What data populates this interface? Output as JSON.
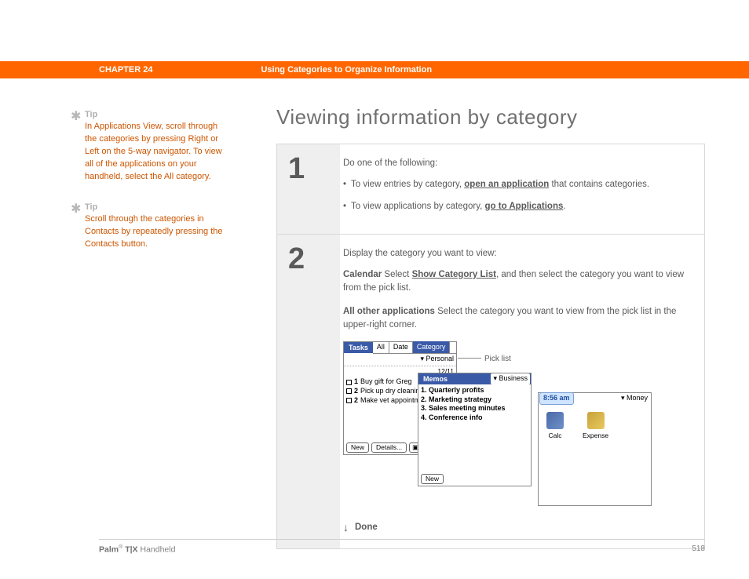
{
  "header": {
    "chapter": "CHAPTER 24",
    "title": "Using Categories to Organize Information"
  },
  "sidebar": {
    "tips": [
      {
        "label": "Tip",
        "text": "In Applications View, scroll through the categories by pressing Right or Left on the 5-way navigator. To view all of the applications on your handheld, select the All category."
      },
      {
        "label": "Tip",
        "text": "Scroll through the categories in Contacts by repeatedly pressing the Contacts button."
      }
    ]
  },
  "page_title": "Viewing information by category",
  "steps": [
    {
      "number": "1",
      "lead": "Do one of the following:",
      "bullets": [
        {
          "pre": "To view entries by category, ",
          "link": "open an application",
          "post": " that contains categories."
        },
        {
          "pre": "To view applications by category, ",
          "link": "go to Applications",
          "post": "."
        }
      ]
    },
    {
      "number": "2",
      "lead": "Display the category you want to view:",
      "paras": [
        {
          "term": "Calendar",
          "pre": "   Select ",
          "link": "Show Category List",
          "post": ", and then select the category you want to view from the pick list."
        },
        {
          "term": "All other applications",
          "pre": "   Select the category you want to view from the pick list in the upper-right corner.",
          "link": "",
          "post": ""
        }
      ],
      "done": "Done"
    }
  ],
  "callout": {
    "label": "Pick list"
  },
  "palm": {
    "tasks": {
      "title": "Tasks",
      "tabs": [
        "All",
        "Date",
        "Category"
      ],
      "picker": "▾ Personal",
      "date": "12/11",
      "rows": [
        {
          "pri": "1",
          "text": "Buy gift for Greg"
        },
        {
          "pri": "2",
          "text": "Pick up dry cleaning"
        },
        {
          "pri": "2",
          "text": "Make vet appointment"
        }
      ],
      "buttons": [
        "New",
        "Details...",
        "▣"
      ]
    },
    "memos": {
      "title": "Memos",
      "picker": "▾ Business",
      "items": [
        "1. Quarterly profits",
        "2. Marketing strategy",
        "3. Sales meeting minutes",
        "4. Conference info"
      ],
      "buttons": [
        "New"
      ]
    },
    "apps": {
      "time": "8:56 am",
      "picker": "▾ Money",
      "icons": [
        {
          "name": "Calc"
        },
        {
          "name": "Expense"
        }
      ]
    }
  },
  "footer": {
    "brand_bold": "Palm",
    "brand_reg": "®",
    "brand_model": " T|X",
    "brand_tail": " Handheld",
    "page": "518"
  }
}
